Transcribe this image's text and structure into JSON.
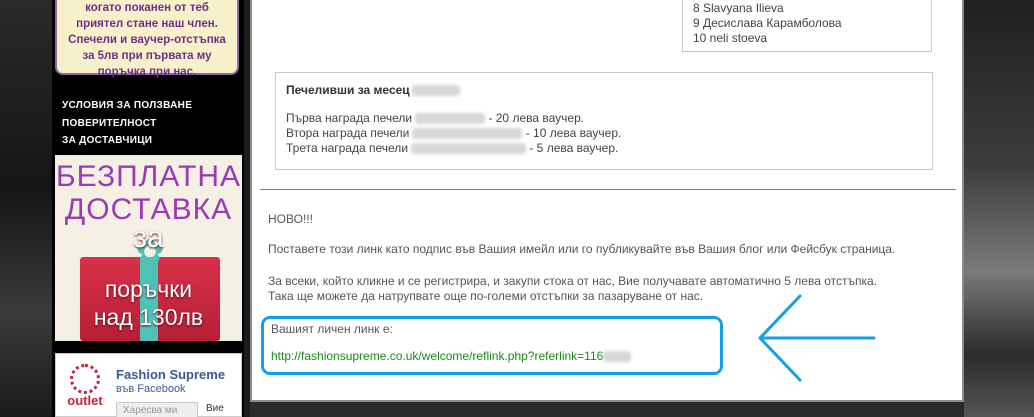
{
  "sidebar": {
    "promo_lines": [
      "когато поканен от теб",
      "приятел стане наш член.",
      "Спечели и ваучер-отстъпка",
      "за 5лв при първата му",
      "поръчка при нас."
    ],
    "links": [
      "УСЛОВИЯ ЗА ПОЛЗВАНЕ",
      "ПОВЕРИТЕЛНОСТ",
      "ЗА ДОСТАВЧИЦИ"
    ],
    "banner": {
      "line1": "БЕЗПЛАТНА",
      "line2": "ДОСТАВКА",
      "za": "за",
      "line3": "поръчки",
      "line4": "над 130лв"
    },
    "facebook": {
      "logo_text": "outlet",
      "page_name": "Fashion Supreme",
      "on_facebook": "във Facebook",
      "like_button": "Харесва ми",
      "extra": "Вие"
    }
  },
  "invite_list": [
    "8 Slavyana Ilieva",
    "9 Десислава Карамболова",
    "10 neli stoeva"
  ],
  "winners": {
    "title": "Печеливши за месец",
    "rows": [
      {
        "prefix": "Първа награда печели",
        "suffix": " - 20 лева ваучер."
      },
      {
        "prefix": "Втора награда печели",
        "suffix": " - 10 лева ваучер."
      },
      {
        "prefix": "Трета награда печели",
        "suffix": " - 5 лева ваучер."
      }
    ]
  },
  "content": {
    "new_label": "НОВО!!!",
    "instruction": "Поставете този линк като подпис във Вашия имейл или го публикувайте във Вашия блог или Фейсбук страница.",
    "benefit_line1": "За всеки, който кликне и се регистрира, и закупи стока от нас, Вие получавате автоматично 5 лева отстъпка.",
    "benefit_line2": "Така ще можете да натрупвате още по-големи отстъпки за пазаруване от нас.",
    "link_label": "Вашият личен линк е:",
    "link_url": "http://fashionsupreme.co.uk/welcome/reflink.php?referlink=116"
  },
  "colors": {
    "highlight_border": "#15a0e3",
    "link_green": "#1b8a17",
    "banner_purple": "#9c39b4"
  }
}
